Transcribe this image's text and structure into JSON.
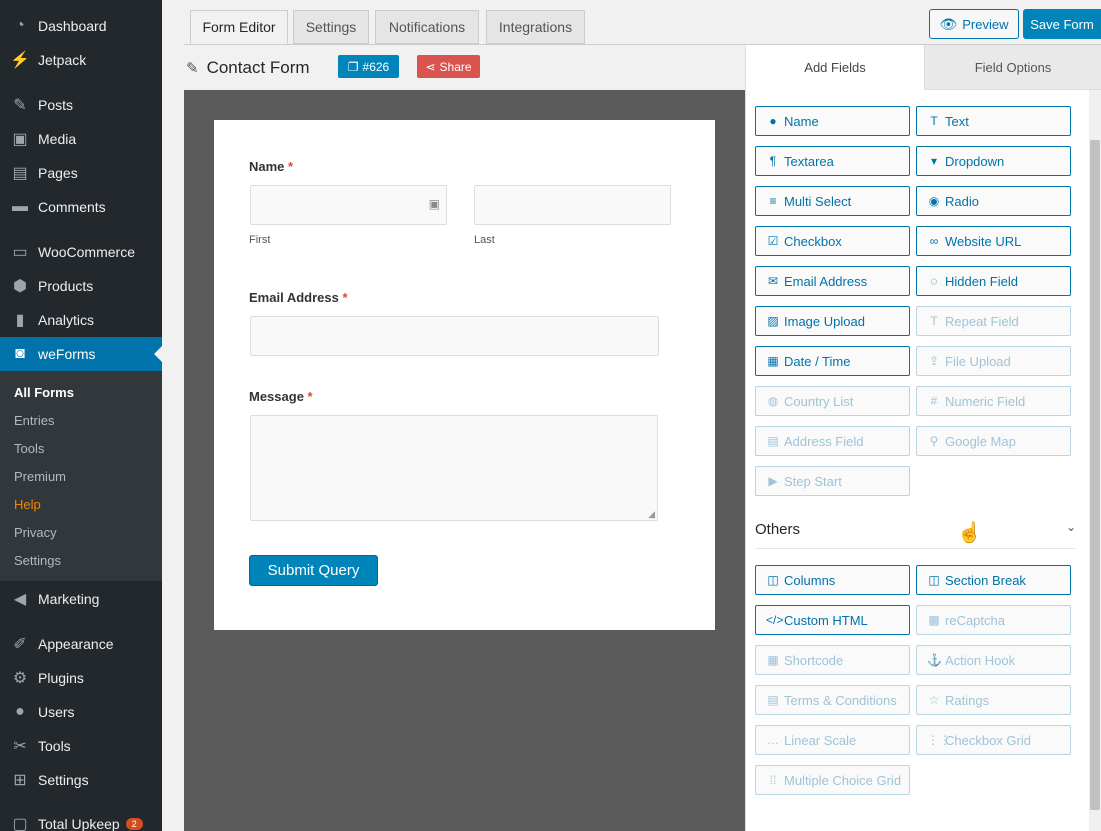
{
  "sidebar": {
    "items": [
      {
        "label": "Dashboard",
        "icon": "dashboard-icon",
        "glyph": "◔"
      },
      {
        "label": "Jetpack",
        "icon": "jetpack-icon",
        "glyph": "⚡"
      },
      {
        "label": "Posts",
        "icon": "pin-icon",
        "glyph": "✎"
      },
      {
        "label": "Media",
        "icon": "media-icon",
        "glyph": "▣"
      },
      {
        "label": "Pages",
        "icon": "pages-icon",
        "glyph": "▤"
      },
      {
        "label": "Comments",
        "icon": "comment-icon",
        "glyph": "▬"
      },
      {
        "label": "WooCommerce",
        "icon": "woocommerce-icon",
        "glyph": "▭"
      },
      {
        "label": "Products",
        "icon": "products-icon",
        "glyph": "⬢"
      },
      {
        "label": "Analytics",
        "icon": "analytics-icon",
        "glyph": "▮"
      },
      {
        "label": "weForms",
        "icon": "weforms-icon",
        "glyph": "◙"
      },
      {
        "label": "Marketing",
        "icon": "megaphone-icon",
        "glyph": "◀"
      },
      {
        "label": "Appearance",
        "icon": "brush-icon",
        "glyph": "✐"
      },
      {
        "label": "Plugins",
        "icon": "plugin-icon",
        "glyph": "⚙"
      },
      {
        "label": "Users",
        "icon": "users-icon",
        "glyph": "●"
      },
      {
        "label": "Tools",
        "icon": "wrench-icon",
        "glyph": "✂"
      },
      {
        "label": "Settings",
        "icon": "settings-icon",
        "glyph": "⊞"
      },
      {
        "label": "Total Upkeep",
        "icon": "upkeep-icon",
        "glyph": "▢"
      }
    ],
    "submenu": [
      "All Forms",
      "Entries",
      "Tools",
      "Premium",
      "Help",
      "Privacy",
      "Settings"
    ],
    "upkeep_badge": "2"
  },
  "tabs": [
    "Form Editor",
    "Settings",
    "Notifications",
    "Integrations"
  ],
  "header": {
    "preview": "Preview",
    "save": "Save Form"
  },
  "form": {
    "title": "Contact Form",
    "id_label": "#626",
    "share_label": "Share",
    "name_label": "Name",
    "first_label": "First",
    "last_label": "Last",
    "email_label": "Email Address",
    "message_label": "Message",
    "required_mark": "*",
    "submit": "Submit Query"
  },
  "panel": {
    "tabs": [
      "Add Fields",
      "Field Options"
    ],
    "fields": [
      {
        "label": "Name",
        "icon": "user-icon",
        "glyph": "●",
        "enabled": true
      },
      {
        "label": "Text",
        "icon": "text-icon",
        "glyph": "T",
        "enabled": true
      },
      {
        "label": "Textarea",
        "icon": "paragraph-icon",
        "glyph": "¶",
        "enabled": true
      },
      {
        "label": "Dropdown",
        "icon": "dropdown-icon",
        "glyph": "▾",
        "enabled": true
      },
      {
        "label": "Multi Select",
        "icon": "list-icon",
        "glyph": "≡",
        "enabled": true
      },
      {
        "label": "Radio",
        "icon": "radio-icon",
        "glyph": "◉",
        "enabled": true
      },
      {
        "label": "Checkbox",
        "icon": "checkbox-icon",
        "glyph": "☑",
        "enabled": true
      },
      {
        "label": "Website URL",
        "icon": "link-icon",
        "glyph": "∞",
        "enabled": true
      },
      {
        "label": "Email Address",
        "icon": "envelope-icon",
        "glyph": "✉",
        "enabled": true
      },
      {
        "label": "Hidden Field",
        "icon": "eye-slash-icon",
        "glyph": "◌",
        "enabled": true
      },
      {
        "label": "Image Upload",
        "icon": "image-icon",
        "glyph": "▨",
        "enabled": true
      },
      {
        "label": "Repeat Field",
        "icon": "text-icon",
        "glyph": "T",
        "enabled": false
      },
      {
        "label": "Date / Time",
        "icon": "calendar-icon",
        "glyph": "▦",
        "enabled": true
      },
      {
        "label": "File Upload",
        "icon": "upload-icon",
        "glyph": "⇪",
        "enabled": false
      },
      {
        "label": "Country List",
        "icon": "globe-icon",
        "glyph": "◍",
        "enabled": false
      },
      {
        "label": "Numeric Field",
        "icon": "hash-icon",
        "glyph": "#",
        "enabled": false
      },
      {
        "label": "Address Field",
        "icon": "address-card-icon",
        "glyph": "▤",
        "enabled": false
      },
      {
        "label": "Google Map",
        "icon": "map-marker-icon",
        "glyph": "⚲",
        "enabled": false
      },
      {
        "label": "Step Start",
        "icon": "step-icon",
        "glyph": "▶",
        "enabled": false
      }
    ],
    "others_title": "Others",
    "others": [
      {
        "label": "Columns",
        "icon": "columns-icon",
        "glyph": "◫",
        "enabled": true
      },
      {
        "label": "Section Break",
        "icon": "columns-icon",
        "glyph": "◫",
        "enabled": true
      },
      {
        "label": "Custom HTML",
        "icon": "code-icon",
        "glyph": "</>",
        "enabled": true
      },
      {
        "label": "reCaptcha",
        "icon": "qrcode-icon",
        "glyph": "▩",
        "enabled": false
      },
      {
        "label": "Shortcode",
        "icon": "calendar-icon",
        "glyph": "▦",
        "enabled": false
      },
      {
        "label": "Action Hook",
        "icon": "anchor-icon",
        "glyph": "⚓",
        "enabled": false
      },
      {
        "label": "Terms & Conditions",
        "icon": "file-icon",
        "glyph": "▤",
        "enabled": false
      },
      {
        "label": "Ratings",
        "icon": "star-icon",
        "glyph": "☆",
        "enabled": false
      },
      {
        "label": "Linear Scale",
        "icon": "ellipsis-icon",
        "glyph": "…",
        "enabled": false
      },
      {
        "label": "Checkbox Grid",
        "icon": "grid-icon",
        "glyph": "⋮⋮",
        "enabled": false
      },
      {
        "label": "Multiple Choice Grid",
        "icon": "grid-dots-icon",
        "glyph": "⁞⁞",
        "enabled": false
      }
    ]
  }
}
